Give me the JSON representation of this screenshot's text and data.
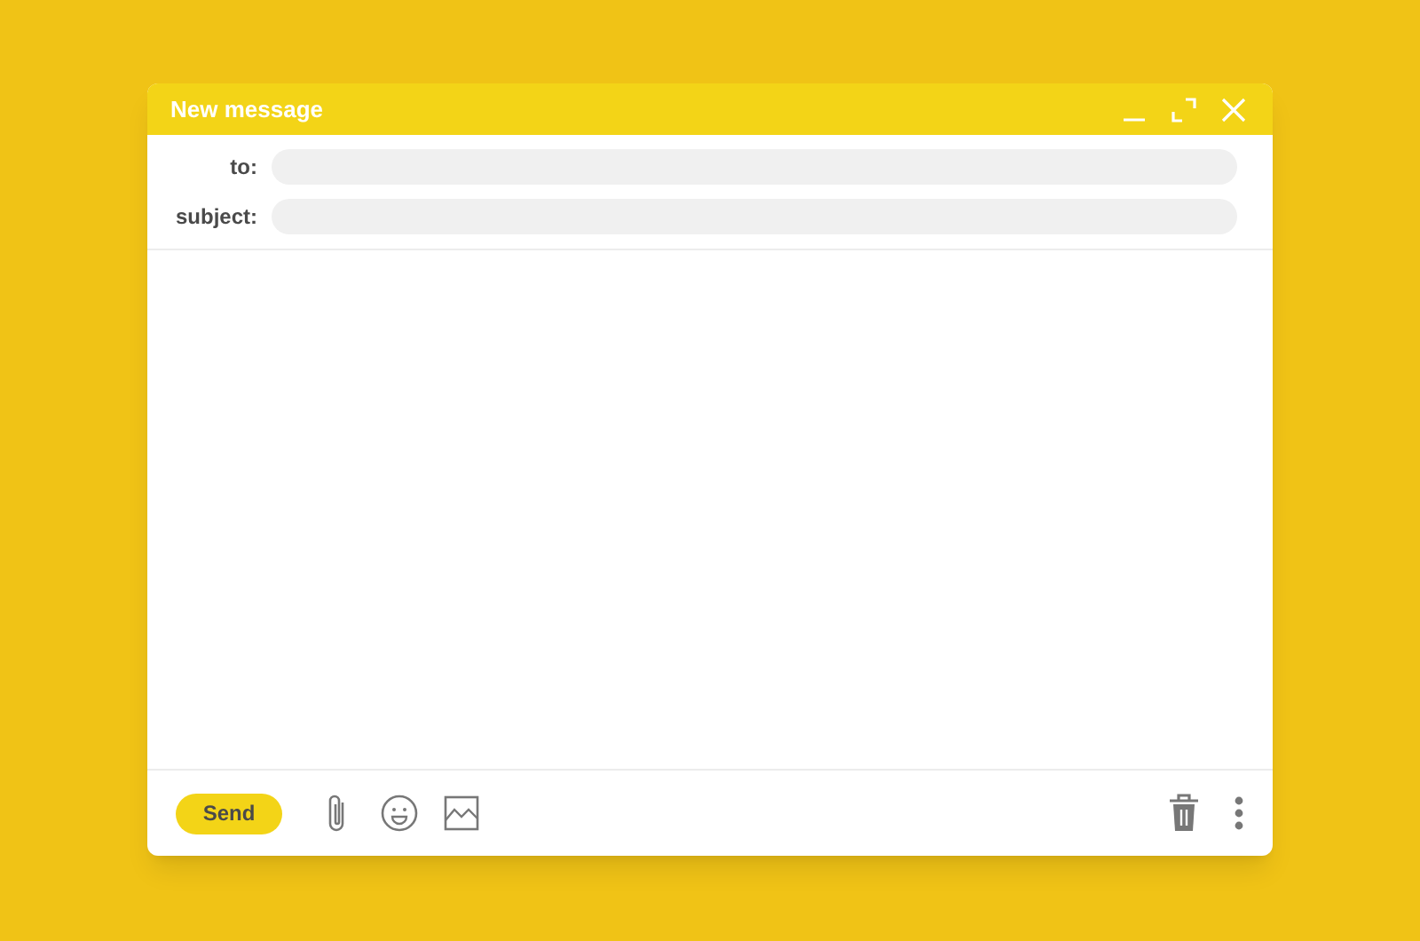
{
  "window": {
    "title": "New message"
  },
  "fields": [
    {
      "label": "to:"
    },
    {
      "label": "subject:"
    }
  ],
  "footer": {
    "send_button": "Send"
  }
}
